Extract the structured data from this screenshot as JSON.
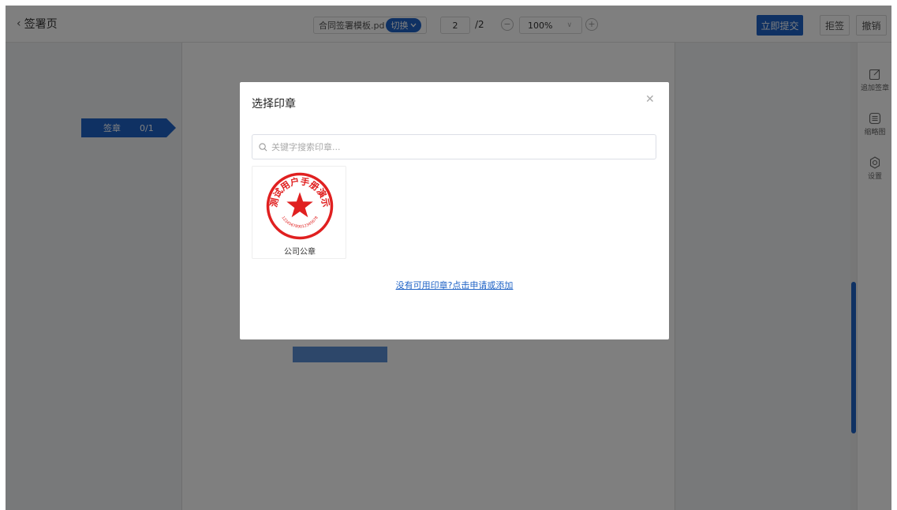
{
  "topbar": {
    "back_label": "签署页",
    "file_name": "合同签署模板.pd",
    "switch_label": "切换",
    "page_current": "2",
    "page_total": "/2",
    "zoom_value": "100%",
    "submit_label": "立即提交",
    "reject_label": "拒签",
    "revoke_label": "撤销"
  },
  "document": {
    "sign_tag_label": "签章",
    "sign_tag_count": "0/1"
  },
  "sidebar": {
    "items": [
      {
        "label": "追加签章",
        "icon": "edit-icon"
      },
      {
        "label": "缩略图",
        "icon": "list-icon"
      },
      {
        "label": "设置",
        "icon": "gear-icon"
      }
    ]
  },
  "modal": {
    "title": "选择印章",
    "search_placeholder": "关键字搜索印章...",
    "seals": [
      {
        "name": "公司公章",
        "ring_text": "测试用户手册演示",
        "serial_text": "123456789012345678",
        "color": "#e02020"
      }
    ],
    "apply_link": "没有可用印章?点击申请或添加"
  },
  "colors": {
    "primary": "#1f63c6",
    "seal_red": "#e02020"
  }
}
